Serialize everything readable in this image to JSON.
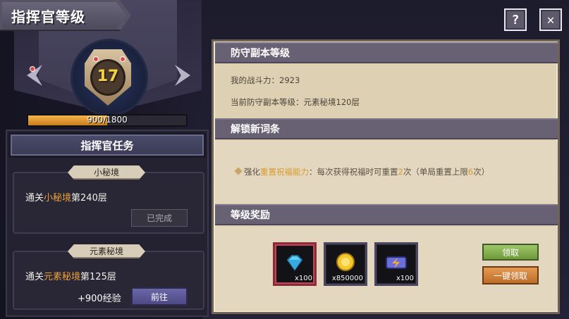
{
  "header": {
    "title": "指挥官等级",
    "help_icon": "question-icon",
    "close_icon": "close-icon",
    "help_label": "?",
    "close_label": "✕"
  },
  "commander": {
    "level": "17",
    "exp_text": "900/1800",
    "exp_fraction": 0.5
  },
  "tasks": {
    "header": "指挥官任务",
    "items": [
      {
        "ribbon": "小秘境",
        "text_prefix": "通关",
        "text_highlight": "小秘境",
        "text_suffix": "第240层",
        "status_label": "已完成"
      },
      {
        "ribbon": "元素秘境",
        "text_prefix": "通关",
        "text_highlight": "元素秘境",
        "text_suffix": "第125层",
        "reward_text": "+900经验",
        "action_label": "前往"
      }
    ]
  },
  "right_panel": {
    "defense_section": {
      "title": "防守副本等级",
      "power_label": "我的战斗力：2923",
      "level_label": "当前防守副本等级：元素秘境120层"
    },
    "unlock_section": {
      "title": "解锁新词条",
      "bullet_icon": "diamond-bullet-icon",
      "text_prefix": "强化",
      "text_highlight": "重置祝福能力",
      "text_middle": "：每次获得祝福时可重置",
      "count1": "2",
      "text_middle2": "次（单局重置上限",
      "count2": "6",
      "text_end": "次）"
    },
    "rewards_section": {
      "title": "等级奖励",
      "items": [
        {
          "icon": "diamond-icon",
          "count": "x100"
        },
        {
          "icon": "gold-coin-icon",
          "count": "x850000"
        },
        {
          "icon": "energy-battery-icon",
          "count": "x100"
        }
      ],
      "claim_label": "领取",
      "claim_all_label": "一键领取"
    }
  },
  "colors": {
    "accent_orange": "#f0a23a",
    "level_yellow": "#f4d23a",
    "panel_bg": "#ddd0b3",
    "claim_green": "#8ab656",
    "claim_all_orange": "#d8843e"
  }
}
